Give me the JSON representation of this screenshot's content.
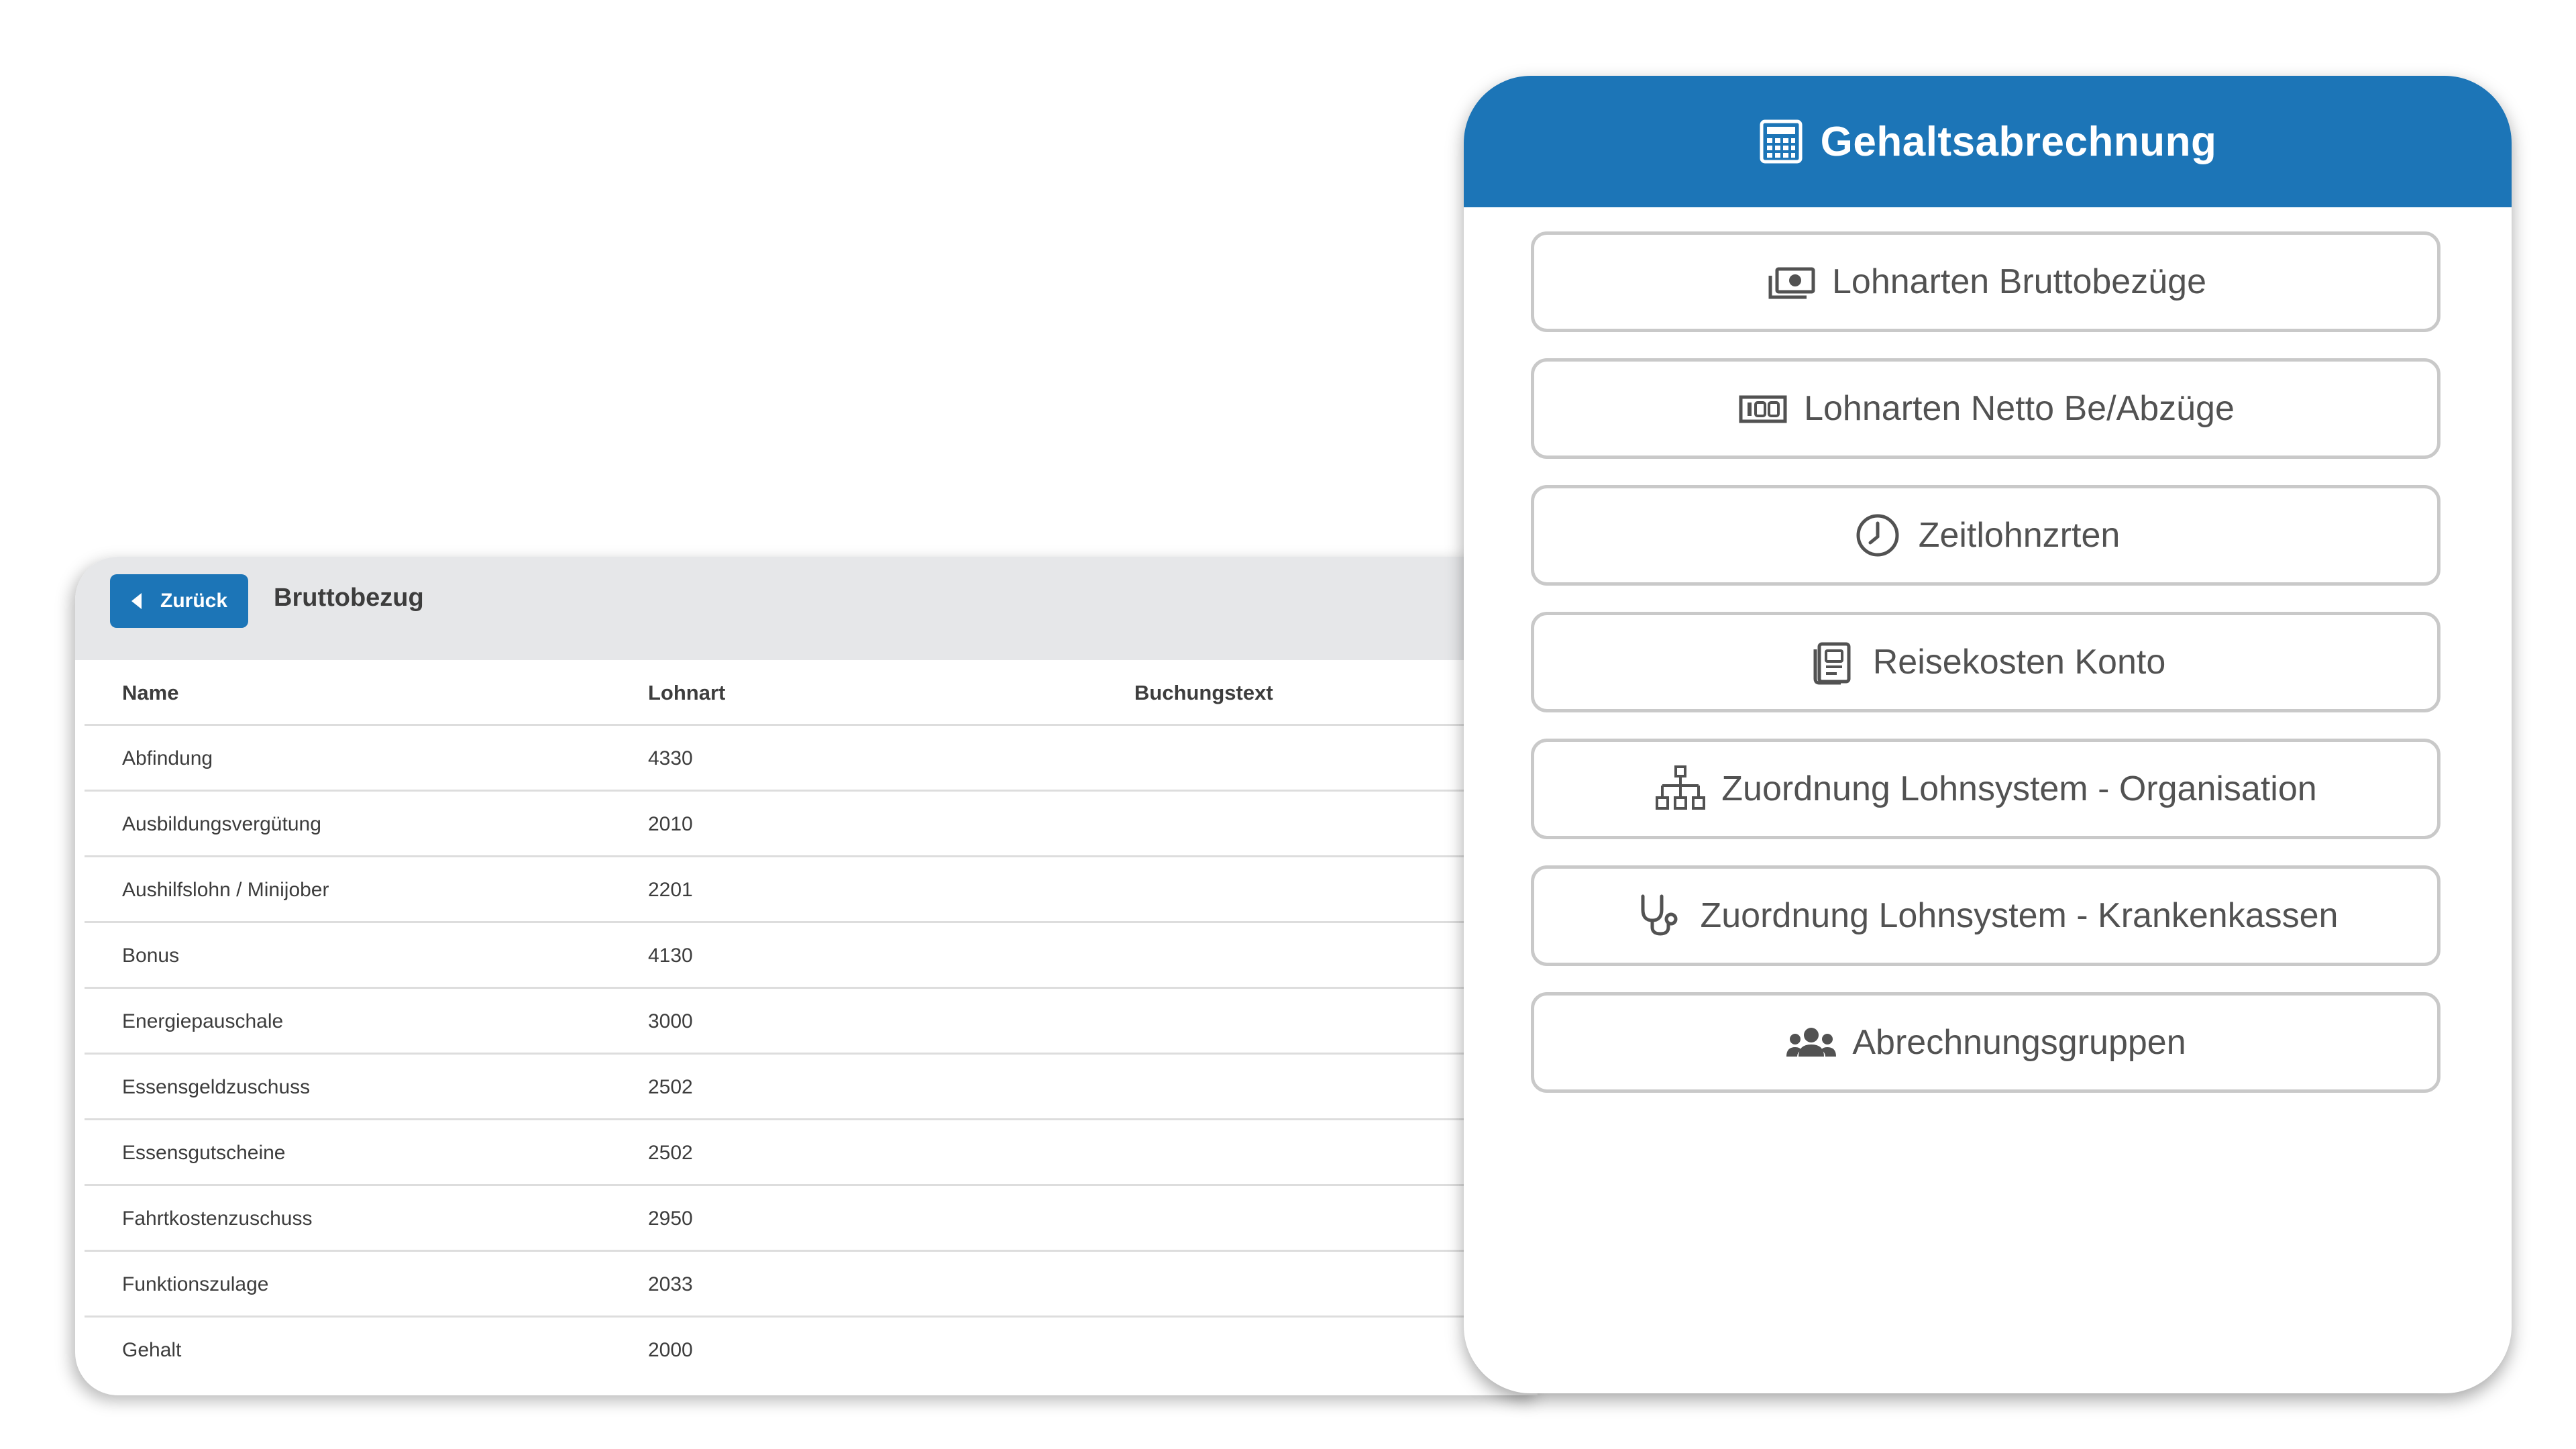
{
  "table_panel": {
    "back_label": "Zurück",
    "title": "Bruttobezug",
    "columns": [
      "Name",
      "Lohnart",
      "Buchungstext"
    ],
    "rows": [
      {
        "name": "Abfindung",
        "code": "4330",
        "text": ""
      },
      {
        "name": "Ausbildungsvergütung",
        "code": "2010",
        "text": ""
      },
      {
        "name": "Aushilfslohn / Minijober",
        "code": "2201",
        "text": ""
      },
      {
        "name": "Bonus",
        "code": "4130",
        "text": ""
      },
      {
        "name": "Energiepauschale",
        "code": "3000",
        "text": ""
      },
      {
        "name": "Essensgeldzuschuss",
        "code": "2502",
        "text": ""
      },
      {
        "name": "Essensgutscheine",
        "code": "2502",
        "text": ""
      },
      {
        "name": "Fahrtkostenzuschuss",
        "code": "2950",
        "text": ""
      },
      {
        "name": "Funktionszulage",
        "code": "2033",
        "text": ""
      },
      {
        "name": "Gehalt",
        "code": "2000",
        "text": ""
      }
    ]
  },
  "menu_panel": {
    "title": "Gehaltsabrechnung",
    "title_icon": "calculator-icon",
    "items": [
      {
        "label": "Lohnarten Bruttobezüge",
        "icon": "money-icon"
      },
      {
        "label": "Lohnarten Netto Be/Abzüge",
        "icon": "counter-icon"
      },
      {
        "label": "Zeitlohnzrten",
        "icon": "clock-icon"
      },
      {
        "label": "Reisekosten Konto",
        "icon": "receipt-icon"
      },
      {
        "label": "Zuordnung Lohnsystem - Organisation",
        "icon": "org-chart-icon"
      },
      {
        "label": "Zuordnung Lohnsystem - Krankenkassen",
        "icon": "stethoscope-icon"
      },
      {
        "label": "Abrechnungsgruppen",
        "icon": "users-icon"
      }
    ]
  },
  "colors": {
    "accent_blue": "#1c75b7",
    "header_gray": "#e6e7e9",
    "button_border": "#c9c9c9",
    "text_dark": "#3d3d3d",
    "text_menu": "#525252"
  }
}
